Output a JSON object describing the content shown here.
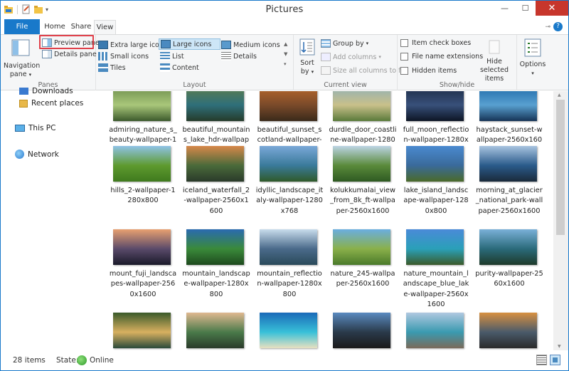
{
  "window": {
    "title": "Pictures"
  },
  "tabs": {
    "file": "File",
    "home": "Home",
    "share": "Share",
    "view": "View"
  },
  "ribbon": {
    "panes": {
      "label": "Panes",
      "navigation_pane": "Navigation",
      "navigation_pane2": "pane",
      "preview_pane": "Preview pane",
      "details_pane": "Details pane"
    },
    "layout": {
      "label": "Layout",
      "extra_large_icons": "Extra large icons",
      "large_icons": "Large icons",
      "medium_icons": "Medium icons",
      "small_icons": "Small icons",
      "list": "List",
      "details": "Details",
      "tiles": "Tiles",
      "content": "Content",
      "selected": "Large icons"
    },
    "current_view": {
      "label": "Current view",
      "sort_by": "Sort",
      "sort_by2": "by",
      "group_by": "Group by",
      "add_columns": "Add columns",
      "size_all_columns": "Size all columns to fit"
    },
    "show_hide": {
      "label": "Show/hide",
      "item_check_boxes": "Item check boxes",
      "file_name_extensions": "File name extensions",
      "hidden_items": "Hidden items",
      "hide_selected_items": "Hide selected",
      "hide_selected_items2": "items"
    },
    "options": {
      "label": "Options"
    }
  },
  "nav": {
    "downloads": "Downloads",
    "recent_places": "Recent places",
    "this_pc": "This PC",
    "network": "Network"
  },
  "files": [
    {
      "name": "admiring_nature_s_beauty-wallpaper-1280x800",
      "colors": [
        "#6a8c4a",
        "#a9c77a",
        "#3c5a2c"
      ]
    },
    {
      "name": "beautiful_mountains_lake_hdr-wallpaper-2560x1600",
      "colors": [
        "#5e7d4a",
        "#2f6f7a",
        "#253b2a"
      ]
    },
    {
      "name": "beautiful_sunset_scotland-wallpaper-1280x800",
      "colors": [
        "#b8682a",
        "#7a4a2a",
        "#3a2a1a"
      ]
    },
    {
      "name": "durdle_door_coastline-wallpaper-1280x800",
      "colors": [
        "#8fb0b8",
        "#c9c08a",
        "#5a7a3a"
      ]
    },
    {
      "name": "full_moon_reflection-wallpaper-1280x800",
      "colors": [
        "#1b2a44",
        "#38507a",
        "#0d1525"
      ]
    },
    {
      "name": "haystack_sunset-wallpaper-2560x1600",
      "colors": [
        "#1f6aa8",
        "#58a0d0",
        "#163456"
      ]
    },
    {
      "name": "hills_2-wallpaper-1280x800",
      "colors": [
        "#8fc3e6",
        "#5e9a2e",
        "#3f7a1e"
      ]
    },
    {
      "name": "iceland_waterfall_2-wallpaper-2560x1600",
      "colors": [
        "#d7884a",
        "#4a6a3a",
        "#2a3a2a"
      ]
    },
    {
      "name": "idyllic_landscape_italy-wallpaper-1280x768",
      "colors": [
        "#7aa8d8",
        "#3a7a9a",
        "#2f5a2a"
      ]
    },
    {
      "name": "kolukkumalai_view_from_8k_ft-wallpaper-2560x1600",
      "colors": [
        "#bcd4e4",
        "#5a8a3a",
        "#2e5a22"
      ]
    },
    {
      "name": "lake_island_landscape-wallpaper-1280x800",
      "colors": [
        "#4a8ad0",
        "#3a6a9a",
        "#4a6a2a"
      ]
    },
    {
      "name": "morning_at_glacier_national_park-wallpaper-2560x1600",
      "colors": [
        "#a8c4e0",
        "#2a5a8a",
        "#1a2a3a"
      ]
    },
    {
      "name": "mount_fuji_landscapes-wallpaper-2560x1600",
      "colors": [
        "#e8a070",
        "#5a4a6a",
        "#1a1a2a"
      ]
    },
    {
      "name": "mountain_landscape-wallpaper-1280x800",
      "colors": [
        "#2a6ab0",
        "#3a8a3a",
        "#1e4a1e"
      ]
    },
    {
      "name": "mountain_reflection-wallpaper-1280x800",
      "colors": [
        "#c8dcec",
        "#4a6a8a",
        "#2a4a5a"
      ]
    },
    {
      "name": "nature_245-wallpaper-2560x1600",
      "colors": [
        "#6aaee0",
        "#8ab04a",
        "#4a7a2a"
      ]
    },
    {
      "name": "nature_mountain_landscape_blue_lake-wallpaper-2560x1600",
      "colors": [
        "#4a8ad8",
        "#2aa0b8",
        "#3a5a2a"
      ]
    },
    {
      "name": "purity-wallpaper-2560x1600",
      "colors": [
        "#7ab0d8",
        "#2a6a7a",
        "#1e3a2a"
      ]
    },
    {
      "name": "",
      "colors": [
        "#3a5a2a",
        "#d8b060",
        "#2a4a3a"
      ]
    },
    {
      "name": "",
      "colors": [
        "#e0b890",
        "#4a7a4a",
        "#2a3a2a"
      ]
    },
    {
      "name": "",
      "colors": [
        "#1a6ab8",
        "#38c0d8",
        "#e8e0c0"
      ]
    },
    {
      "name": "",
      "colors": [
        "#5a8ac0",
        "#2a3a4a",
        "#1a1a1a"
      ]
    },
    {
      "name": "",
      "colors": [
        "#b0c8e0",
        "#3a9ab0",
        "#7a6a5a"
      ]
    },
    {
      "name": "",
      "colors": [
        "#d89040",
        "#4a5a6a",
        "#2a2a2a"
      ]
    }
  ],
  "status": {
    "items": "28 items",
    "state_label": "State:",
    "state_value": "Online"
  }
}
